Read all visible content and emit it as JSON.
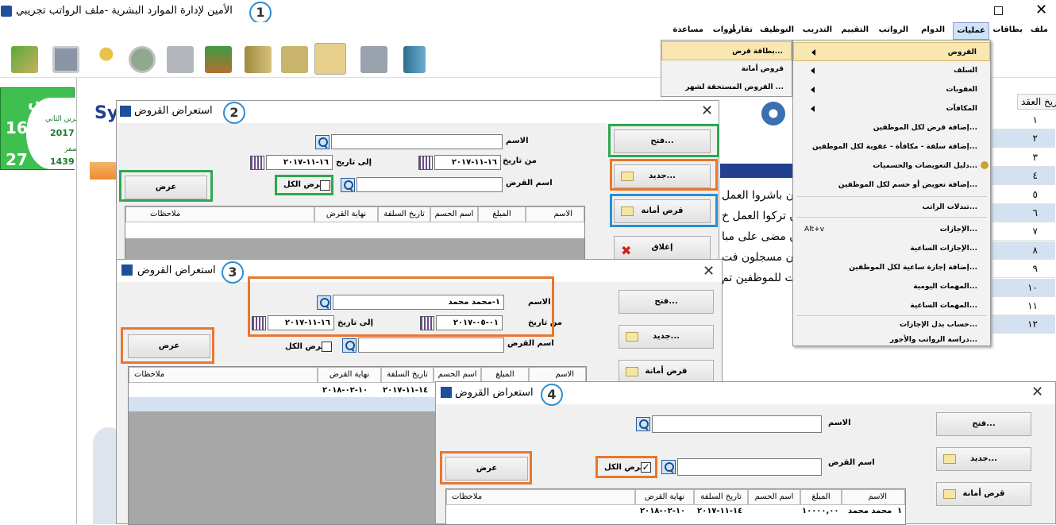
{
  "app": {
    "title": "الأمين لإدارة الموارد البشرية -ملف الرواتب تجريبي",
    "menu": [
      "ملف",
      "بطاقات",
      "عمليات",
      "الدوام",
      "الرواتب",
      "التقييم",
      "التدريب",
      "التوظيف",
      "تقارير",
      "أدوات",
      "مساعدة"
    ]
  },
  "ops_menu": {
    "items": [
      "القروض",
      "السلف",
      "العقوبات",
      "المكافآت",
      "إضافة قرض لكل الموظفين...",
      "إضافة سلفة - مكافأة - عقوبة لكل الموظفين...",
      "دليل التعويضات والحسميات...",
      "إضافة تعويض أو حسم لكل الموظفين...",
      "تبدلات الراتب...",
      "الإجازات...",
      "الإجازات الساعية...",
      "إضافة إجازة ساعية لكل الموظفين...",
      "المهمات اليومية...",
      "المهمات الساعية...",
      "حساب بدل الإجازات...",
      "دراسة الرواتب والأجور..."
    ],
    "shortcut": "Alt+v"
  },
  "loans_submenu": {
    "items": [
      "بطاقة قرض...",
      "قروض أمانة",
      "القروض المستحقة لشهر ..."
    ]
  },
  "calendar": {
    "day": "الخميس",
    "greg_day": "16",
    "greg_month": "تشرين الثاني",
    "greg_year": "2017",
    "hijri_day": "27",
    "hijri_month": "صفر",
    "hijri_year": "1439"
  },
  "bg": {
    "logo": "Sy",
    "lines": [
      "ن باشروا العمل",
      "ن تركوا العمل خ",
      "ن مضى على مبا",
      "ون مسجلون فت",
      "ت للموظفين تم"
    ]
  },
  "right_grid": {
    "header": "تاريخ العقد",
    "rows": [
      "١",
      "٢",
      "٣",
      "٤",
      "٥",
      "٦",
      "٧",
      "٨",
      "٩",
      "١٠",
      "١١",
      "١٢"
    ]
  },
  "dialog": {
    "title": "استعراض القروض",
    "name_label": "الاسم",
    "from_label": "من تاريخ",
    "to_label": "إلى تاريخ",
    "loan_label": "اسم القرض",
    "show_all": "عرض الكل",
    "show_btn": "عرض",
    "open_btn": "فتح...",
    "new_btn": "جديد...",
    "trust_btn": "قرض أمانة",
    "close_btn": "إغلاق",
    "cols": [
      "الاسم",
      "المبلغ",
      "اسم الحسم",
      "تاريخ السلفة",
      "نهاية القرض",
      "ملاحظات"
    ]
  },
  "w2": {
    "from": "١٦-١١-٢٠١٧",
    "to": "١٦-١١-٢٠١٧"
  },
  "w3": {
    "name": "١-محمد محمد",
    "from": "٠١-٠٥-٢٠١٧",
    "to": "١٦-١١-٢٠١٧",
    "row": {
      "start": "١٤-١١-٢٠١٧",
      "end": "١٠-٠٢-٢٠١٨"
    }
  },
  "w4": {
    "row": {
      "idx": "١",
      "name": "محمد محمد",
      "amount": "١٠٠٠٠,٠٠",
      "start": "١٤-١١-٢٠١٧",
      "end": "١٠-٠٢-٢٠١٨"
    }
  },
  "steps": [
    "1",
    "2",
    "3",
    "4"
  ],
  "colors": {
    "green": "#2fa84f",
    "orange": "#e8772e",
    "blue": "#2b8ed0"
  }
}
